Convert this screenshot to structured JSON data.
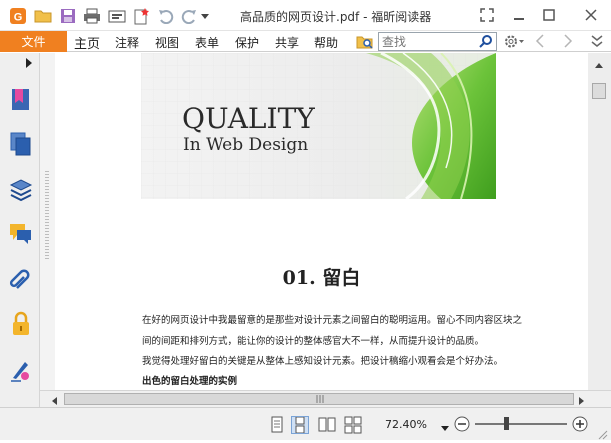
{
  "window": {
    "title": "高品质的网页设计.pdf - 福昕阅读器"
  },
  "menu": {
    "file": "文件",
    "items": [
      "主页",
      "注释",
      "视图",
      "表单",
      "保护",
      "共享",
      "帮助"
    ]
  },
  "search": {
    "placeholder": "查找"
  },
  "document": {
    "banner_title": "QUALITY",
    "banner_subtitle": "In Web Design",
    "heading": "01.  留白",
    "paragraphs": [
      "在好的网页设计中我最留意的是那些对设计元素之间留白的聪明运用。留心不同内容区块之",
      "间的间距和排列方式，能让你的设计的整体感官大不一样，从而提升设计的品质。",
      "我觉得处理好留白的关键是从整体上感知设计元素。把设计稿缩小观看会是个好办法。",
      "出色的留白处理的实例"
    ]
  },
  "status": {
    "zoom": "72.40%"
  },
  "colors": {
    "accent": "#f08020",
    "sidebar_icon": "#2b5fae"
  }
}
